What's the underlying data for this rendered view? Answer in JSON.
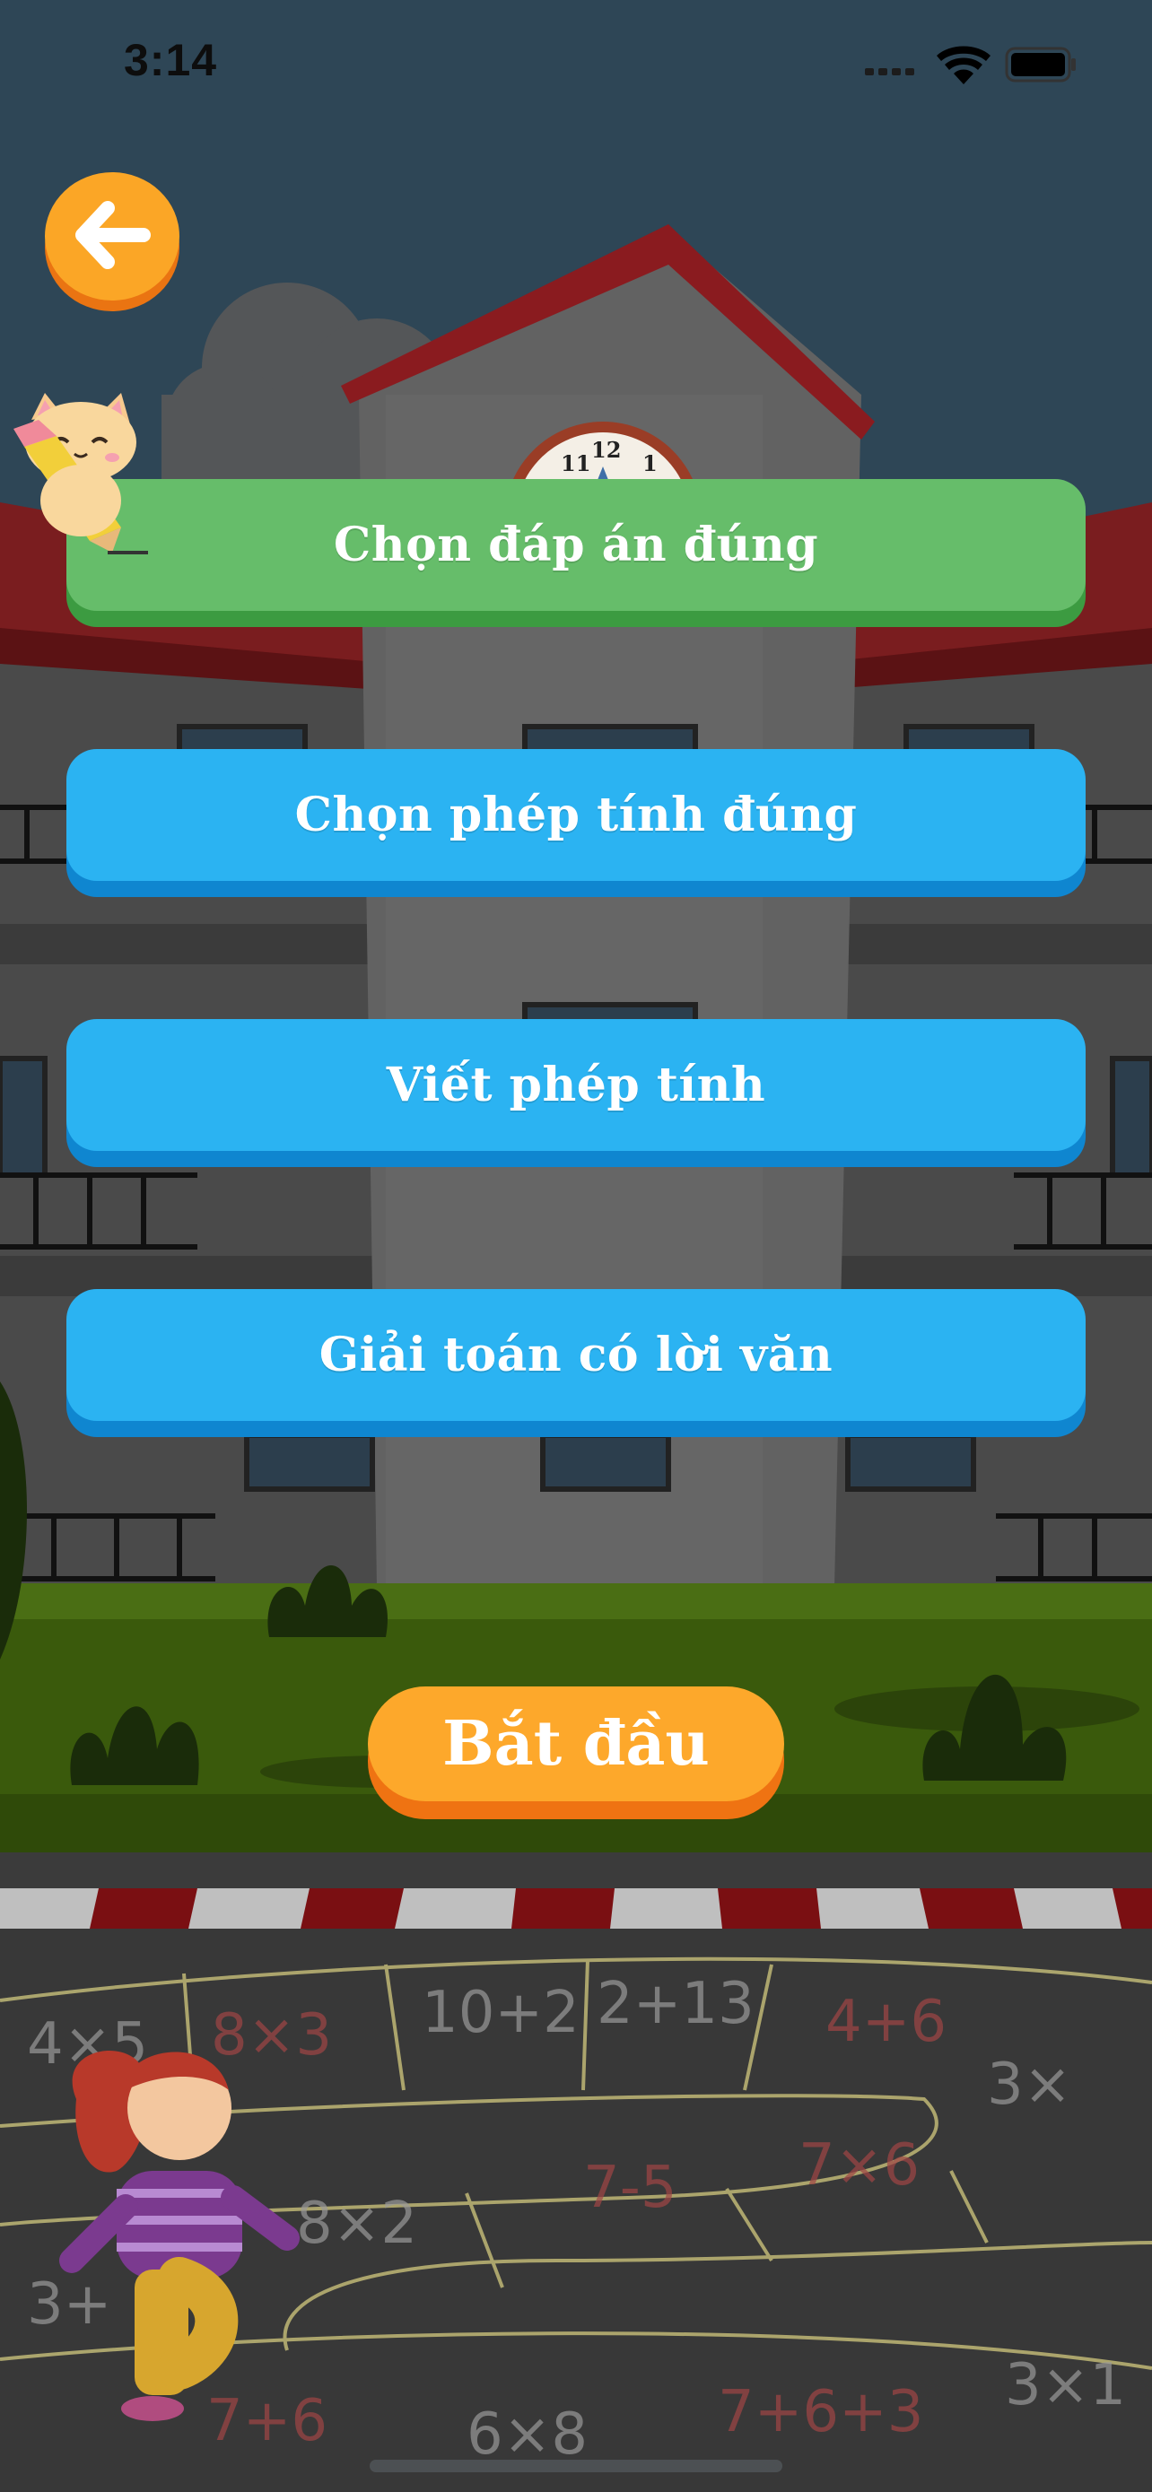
{
  "status_bar": {
    "time": "3:14"
  },
  "back_button": {
    "icon": "arrow-left-icon"
  },
  "clock": {
    "numerals": [
      "11",
      "12",
      "1"
    ]
  },
  "modes": [
    {
      "label": "Chọn đáp án đúng",
      "selected": true
    },
    {
      "label": "Chọn phép tính đúng",
      "selected": false
    },
    {
      "label": "Viết phép tính",
      "selected": false
    },
    {
      "label": "Giải toán có lời văn",
      "selected": false
    }
  ],
  "start_button": {
    "label": "Bắt đầu"
  },
  "chalk_expressions": [
    "4×5",
    "8×3",
    "10+2",
    "2+13",
    "4+6",
    "3×",
    "8×2",
    "7-5",
    "7×6",
    "3+",
    "7+6",
    "6×8",
    "7+6+3",
    "3×1"
  ],
  "colors": {
    "selected_button": "#66bd6a",
    "mode_button": "#2bb3f2",
    "start_button": "#fda82b",
    "back_button": "#fba626"
  }
}
